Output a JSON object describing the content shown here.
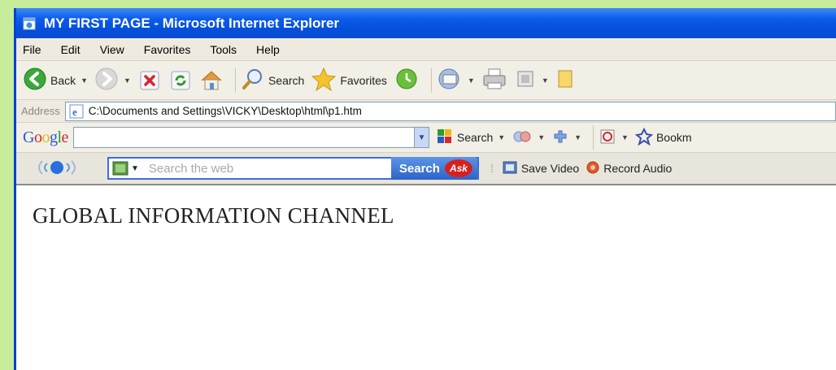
{
  "window": {
    "title": "MY FIRST PAGE - Microsoft Internet Explorer"
  },
  "menu": [
    "File",
    "Edit",
    "View",
    "Favorites",
    "Tools",
    "Help"
  ],
  "toolbar": {
    "back_label": "Back",
    "search_label": "Search",
    "favorites_label": "Favorites"
  },
  "address": {
    "label": "Address",
    "value": "C:\\Documents and Settings\\VICKY\\Desktop\\html\\p1.htm"
  },
  "googlebar": {
    "logo": "Google",
    "search_label": "Search",
    "bookmarks_label": "Bookm"
  },
  "askbar": {
    "placeholder": "Search the web",
    "search_button": "Search",
    "ask_logo": "Ask",
    "save_video": "Save Video",
    "record_audio": "Record Audio"
  },
  "page": {
    "heading": "GLOBAL INFORMATION CHANNEL"
  },
  "colors": {
    "background": "#c6ec9c",
    "titlebar": "#0c5cea",
    "ask_button": "#2c63c8"
  }
}
